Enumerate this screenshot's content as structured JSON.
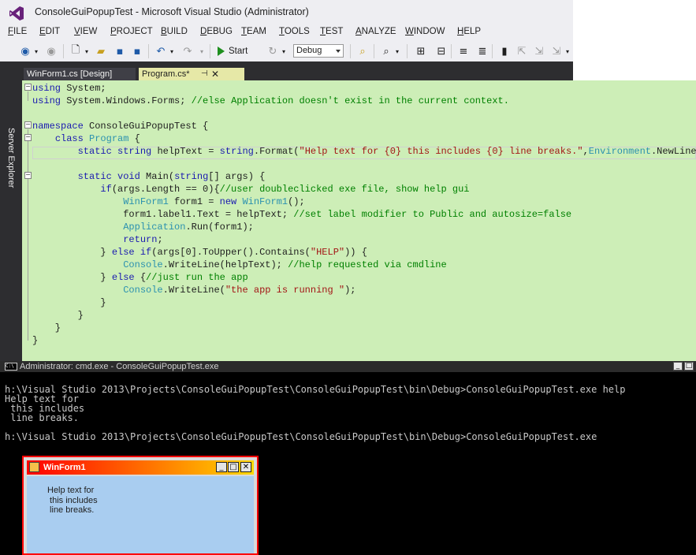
{
  "vs": {
    "title": "ConsoleGuiPopupTest - Microsoft Visual Studio (Administrator)",
    "menu": [
      "FILE",
      "EDIT",
      "VIEW",
      "PROJECT",
      "BUILD",
      "DEBUG",
      "TEAM",
      "TOOLS",
      "TEST",
      "ANALYZE",
      "WINDOW",
      "HELP"
    ],
    "toolbar": {
      "start_label": "Start",
      "configuration": "Debug"
    },
    "side_panel_label": "Server Explorer",
    "tabs": [
      {
        "label": "WinForm1.cs [Design]",
        "active": false
      },
      {
        "label": "Program.cs*",
        "active": true
      }
    ],
    "code_lines": [
      "<span class=\"kw\">using</span> System;",
      "<span class=\"kw\">using</span> System.Windows.Forms; <span class=\"cm\">//else Application doesn't exist in the current context.</span>",
      "",
      "<span class=\"kw\">namespace</span> ConsoleGuiPopupTest {",
      "    <span class=\"kw\">class</span> <span class=\"ty\">Program</span> {",
      "        <span class=\"kw\">static</span> <span class=\"kw\">string</span> helpText = <span class=\"kw\">string</span>.Format(<span class=\"st\">\"Help text for {0} this includes {0} line breaks.\"</span>,<span class=\"ty\">Environment</span>.NewLine);",
      "",
      "        <span class=\"kw\">static</span> <span class=\"kw\">void</span> Main(<span class=\"kw\">string</span>[] args) {",
      "            <span class=\"kw\">if</span>(args.Length == 0){<span class=\"cm\">//user doubleclicked exe file, show help gui</span>",
      "                <span class=\"ty\">WinForm1</span> form1 = <span class=\"kw\">new</span> <span class=\"ty\">WinForm1</span>();",
      "                form1.label1.Text = helpText; <span class=\"cm\">//set label modifier to Public and autosize=false</span>",
      "                <span class=\"ty\">Application</span>.Run(form1);",
      "                <span class=\"kw\">return</span>;",
      "            } <span class=\"kw\">else</span> <span class=\"kw\">if</span>(args[0].ToUpper().Contains(<span class=\"st\">\"HELP\"</span>)) {",
      "                <span class=\"ty\">Console</span>.WriteLine(helpText); <span class=\"cm\">//help requested via cmdline</span>",
      "            } <span class=\"kw\">else</span> {<span class=\"cm\">//just run the app</span>",
      "                <span class=\"ty\">Console</span>.WriteLine(<span class=\"st\">\"the app is running \"</span>);",
      "            }",
      "        }",
      "    }",
      "}"
    ]
  },
  "cmd": {
    "title": "Administrator: cmd.exe - ConsoleGuiPopupTest.exe",
    "lines": [
      "h:\\Visual Studio 2013\\Projects\\ConsoleGuiPopupTest\\ConsoleGuiPopupTest\\bin\\Debug>ConsoleGuiPopupTest.exe help",
      "Help text for",
      " this includes",
      " line breaks.",
      "",
      "h:\\Visual Studio 2013\\Projects\\ConsoleGuiPopupTest\\ConsoleGuiPopupTest\\bin\\Debug>ConsoleGuiPopupTest.exe"
    ]
  },
  "winform": {
    "title": "WinForm1",
    "label": "Help text for\n this includes\n line breaks."
  },
  "colors": {
    "editor_bg": "#cdeeb7",
    "keyword": "#1a1ab0",
    "type": "#2b91af",
    "comment": "#008000",
    "string": "#a31515"
  }
}
